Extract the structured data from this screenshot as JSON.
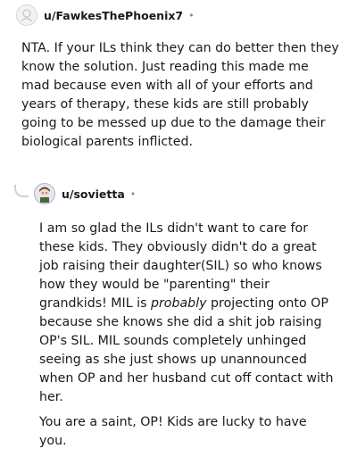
{
  "comments": [
    {
      "username": "u/FawkesThePhoenix7",
      "separator": "•",
      "body": "NTA. If your ILs think they can do better then they know the solution. Just reading this made me mad because even with all of your efforts and years of therapy, these kids are still probably going to be messed up due to the damage their biological parents inflicted."
    },
    {
      "username": "u/sovietta",
      "separator": "•",
      "paragraph1_part1": "I am so glad the ILs didn't want to care for these kids. They obviously didn't do a great job raising their daughter(SIL) so who knows how they would be \"parenting\" their grandkids! MIL is ",
      "paragraph1_emphasis": "probably",
      "paragraph1_part2": " projecting onto OP because she knows she did a shit job raising OP's SIL. MIL sounds completely unhinged seeing as she just shows up unannounced when OP and her husband cut off contact with her.",
      "paragraph2": "You are a saint, OP! Kids are lucky to have you."
    }
  ],
  "icons": {
    "avatar1": "default-avatar-icon",
    "avatar2": "user-avatar-icon",
    "thread": "thread-connector-icon"
  }
}
